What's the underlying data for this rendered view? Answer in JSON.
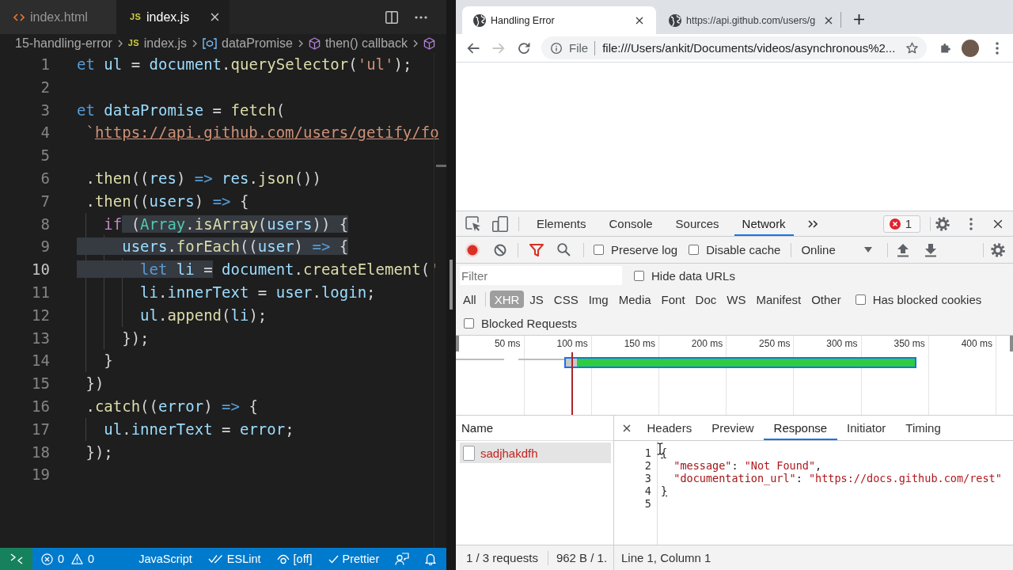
{
  "editor": {
    "tabs": [
      {
        "label": "index.html",
        "kind": "html",
        "selected": false
      },
      {
        "label": "index.js",
        "kind": "js",
        "file_badge": "JS",
        "selected": true
      }
    ],
    "breadcrumbs": [
      {
        "kind": "folder",
        "label": "15-handling-error"
      },
      {
        "kind": "js",
        "file_badge": "JS",
        "label": "index.js"
      },
      {
        "kind": "variable",
        "label": "dataPromise"
      },
      {
        "kind": "method",
        "label": "then() callback"
      },
      {
        "kind": "method"
      }
    ],
    "lines": [
      {
        "number": "1",
        "current": false,
        "tokens": [
          {
            "text": "et",
            "kind": "keyword"
          },
          {
            "text": " ul",
            "kind": "variable"
          },
          {
            "text": " = ",
            "kind": "plain"
          },
          {
            "text": "document",
            "kind": "variable"
          },
          {
            "text": ".",
            "kind": "plain"
          },
          {
            "text": "querySelector",
            "kind": "function"
          },
          {
            "text": "(",
            "kind": "plain"
          },
          {
            "text": "'ul'",
            "kind": "string"
          },
          {
            "text": ");",
            "kind": "plain"
          }
        ]
      },
      {
        "number": "2",
        "current": false
      },
      {
        "number": "3",
        "current": false,
        "tokens": [
          {
            "text": "et",
            "kind": "keyword"
          },
          {
            "text": " dataPromise",
            "kind": "variable"
          },
          {
            "text": " = ",
            "kind": "plain"
          },
          {
            "text": "fetch",
            "kind": "function"
          },
          {
            "text": "(",
            "kind": "plain"
          }
        ]
      },
      {
        "number": "4",
        "current": false,
        "tokens": [
          {
            "text": " `",
            "kind": "string"
          },
          {
            "text": "https://api.github.com/users/getify/fo",
            "kind": "link"
          }
        ]
      },
      {
        "number": "5",
        "current": false
      },
      {
        "number": "6",
        "current": false,
        "tokens": [
          {
            "text": " .",
            "kind": "plain"
          },
          {
            "text": "then",
            "kind": "function"
          },
          {
            "text": "((",
            "kind": "plain"
          },
          {
            "text": "res",
            "kind": "variable"
          },
          {
            "text": ") ",
            "kind": "plain"
          },
          {
            "text": "=>",
            "kind": "keyword"
          },
          {
            "text": " res",
            "kind": "variable"
          },
          {
            "text": ".",
            "kind": "plain"
          },
          {
            "text": "json",
            "kind": "function"
          },
          {
            "text": "())",
            "kind": "plain"
          }
        ]
      },
      {
        "number": "7",
        "current": false,
        "tokens": [
          {
            "text": " .",
            "kind": "plain"
          },
          {
            "text": "then",
            "kind": "function"
          },
          {
            "text": "((",
            "kind": "plain"
          },
          {
            "text": "users",
            "kind": "variable"
          },
          {
            "text": ") ",
            "kind": "plain"
          },
          {
            "text": "=>",
            "kind": "keyword"
          },
          {
            "text": " {",
            "kind": "plain"
          }
        ]
      },
      {
        "number": "8",
        "current": false,
        "tokens": [
          {
            "text": "   if",
            "kind": "control",
            "selected": false
          },
          {
            "text": " (",
            "kind": "plain",
            "selected": true
          },
          {
            "text": "Array",
            "kind": "class",
            "selected": true
          },
          {
            "text": ".",
            "kind": "plain",
            "selected": true
          },
          {
            "text": "isArray",
            "kind": "function",
            "selected": true
          },
          {
            "text": "(",
            "kind": "plain",
            "selected": true
          },
          {
            "text": "users",
            "kind": "variable",
            "selected": true
          },
          {
            "text": ")) {",
            "kind": "plain",
            "selected": true
          }
        ]
      },
      {
        "number": "9",
        "current": false,
        "tokens": [
          {
            "text": "     users",
            "kind": "variable",
            "selected": true
          },
          {
            "text": ".",
            "kind": "plain",
            "selected": true
          },
          {
            "text": "forEach",
            "kind": "function",
            "selected": true
          },
          {
            "text": "((",
            "kind": "plain",
            "selected": true
          },
          {
            "text": "user",
            "kind": "variable",
            "selected": true
          },
          {
            "text": ") ",
            "kind": "plain",
            "selected": true
          },
          {
            "text": "=>",
            "kind": "keyword",
            "selected": true
          },
          {
            "text": " {",
            "kind": "plain",
            "selected": true
          }
        ]
      },
      {
        "number": "10",
        "current": true,
        "tokens": [
          {
            "text": "       let",
            "kind": "keyword",
            "selected": true
          },
          {
            "text": " li",
            "kind": "variable",
            "selected": true
          },
          {
            "text": " =",
            "kind": "plain",
            "selected": true
          },
          {
            "text": " document",
            "kind": "variable",
            "selected": false
          },
          {
            "text": ".",
            "kind": "plain",
            "selected": false
          },
          {
            "text": "createElement",
            "kind": "function",
            "selected": false
          },
          {
            "text": "(",
            "kind": "plain",
            "selected": false
          },
          {
            "text": "'",
            "kind": "string",
            "selected": false
          }
        ]
      },
      {
        "number": "11",
        "current": false,
        "tokens": [
          {
            "text": "       li",
            "kind": "variable"
          },
          {
            "text": ".",
            "kind": "plain"
          },
          {
            "text": "innerText",
            "kind": "variable"
          },
          {
            "text": " = ",
            "kind": "plain"
          },
          {
            "text": "user",
            "kind": "variable"
          },
          {
            "text": ".",
            "kind": "plain"
          },
          {
            "text": "login",
            "kind": "variable"
          },
          {
            "text": ";",
            "kind": "plain"
          }
        ]
      },
      {
        "number": "12",
        "current": false,
        "tokens": [
          {
            "text": "       ul",
            "kind": "variable"
          },
          {
            "text": ".",
            "kind": "plain"
          },
          {
            "text": "append",
            "kind": "function"
          },
          {
            "text": "(",
            "kind": "plain"
          },
          {
            "text": "li",
            "kind": "variable"
          },
          {
            "text": ");",
            "kind": "plain"
          }
        ]
      },
      {
        "number": "13",
        "current": false,
        "tokens": [
          {
            "text": "     });",
            "kind": "plain"
          }
        ]
      },
      {
        "number": "14",
        "current": false,
        "tokens": [
          {
            "text": "   }",
            "kind": "plain"
          }
        ]
      },
      {
        "number": "15",
        "current": false,
        "tokens": [
          {
            "text": " })",
            "kind": "plain"
          }
        ]
      },
      {
        "number": "16",
        "current": false,
        "tokens": [
          {
            "text": " .",
            "kind": "plain"
          },
          {
            "text": "catch",
            "kind": "function"
          },
          {
            "text": "((",
            "kind": "plain"
          },
          {
            "text": "error",
            "kind": "variable"
          },
          {
            "text": ") ",
            "kind": "plain"
          },
          {
            "text": "=>",
            "kind": "keyword"
          },
          {
            "text": " {",
            "kind": "plain"
          }
        ]
      },
      {
        "number": "17",
        "current": false,
        "tokens": [
          {
            "text": "   ul",
            "kind": "variable"
          },
          {
            "text": ".",
            "kind": "plain"
          },
          {
            "text": "innerText",
            "kind": "variable"
          },
          {
            "text": " = ",
            "kind": "plain"
          },
          {
            "text": "error",
            "kind": "variable"
          },
          {
            "text": ";",
            "kind": "plain"
          }
        ]
      },
      {
        "number": "18",
        "current": false,
        "tokens": [
          {
            "text": " });",
            "kind": "plain"
          }
        ]
      },
      {
        "number": "19",
        "current": false
      }
    ],
    "status_bar": {
      "problems": [
        {
          "kind": "error",
          "count": "0"
        },
        {
          "kind": "warning",
          "count": "0"
        }
      ],
      "items": [
        {
          "kind": "language",
          "label": "JavaScript"
        },
        {
          "kind": "eslint",
          "label": "ESLint"
        },
        {
          "kind": "watch",
          "label": "[off]"
        },
        {
          "kind": "prettier",
          "label": "Prettier"
        },
        {
          "kind": "feedback"
        },
        {
          "kind": "notifications"
        }
      ]
    }
  },
  "browser": {
    "tabs": [
      {
        "title": "Handling Error",
        "selected": true
      },
      {
        "title": "https://api.github.com/users/g",
        "selected": false
      }
    ],
    "nav": [
      {
        "kind": "back",
        "disabled": false
      },
      {
        "kind": "forward",
        "disabled": true
      },
      {
        "kind": "reload",
        "disabled": false
      }
    ],
    "omnibox": {
      "scheme": "File",
      "url": "file:///Users/ankit/Documents/videos/asynchronous%2..."
    }
  },
  "devtools": {
    "panels": [
      {
        "label": "Elements",
        "selected": false
      },
      {
        "label": "Console",
        "selected": false
      },
      {
        "label": "Sources",
        "selected": false
      },
      {
        "label": "Network",
        "selected": true
      }
    ],
    "error_count": "1",
    "recording": true,
    "options": [
      {
        "label": "Preserve log",
        "checked": false
      },
      {
        "label": "Disable cache",
        "checked": false
      }
    ],
    "throttling": "Online",
    "filter": {
      "placeholder": "Filter"
    },
    "hide_data_urls": {
      "label": "Hide data URLs",
      "checked": false
    },
    "resource_types": [
      {
        "label": "All",
        "selected": false
      },
      {
        "label": "XHR",
        "selected": true
      },
      {
        "label": "JS",
        "selected": false
      },
      {
        "label": "CSS",
        "selected": false
      },
      {
        "label": "Img",
        "selected": false
      },
      {
        "label": "Media",
        "selected": false
      },
      {
        "label": "Font",
        "selected": false
      },
      {
        "label": "Doc",
        "selected": false
      },
      {
        "label": "WS",
        "selected": false
      },
      {
        "label": "Manifest",
        "selected": false
      },
      {
        "label": "Other",
        "selected": false
      }
    ],
    "has_blocked_cookies": {
      "label": "Has blocked cookies",
      "checked": false
    },
    "blocked_requests": {
      "label": "Blocked Requests",
      "checked": false
    },
    "timeline": {
      "ticks": [
        "50 ms",
        "100 ms",
        "150 ms",
        "200 ms",
        "250 ms",
        "300 ms",
        "350 ms",
        "400 ms"
      ]
    },
    "requests": {
      "column": "Name",
      "rows": [
        {
          "name": "sadjhakdfh",
          "failed": true,
          "selected": true
        }
      ]
    },
    "detail_tabs": [
      {
        "label": "Headers",
        "selected": false
      },
      {
        "label": "Preview",
        "selected": false
      },
      {
        "label": "Response",
        "selected": true
      },
      {
        "label": "Initiator",
        "selected": false
      },
      {
        "label": "Timing",
        "selected": false
      }
    ],
    "response": [
      {
        "number": "1",
        "tokens": [
          {
            "text": "{",
            "kind": "brace"
          }
        ]
      },
      {
        "number": "2",
        "tokens": [
          {
            "text": "  \"message\"",
            "kind": "key"
          },
          {
            "text": ": ",
            "kind": "plain"
          },
          {
            "text": "\"Not Found\"",
            "kind": "string"
          },
          {
            "text": ",",
            "kind": "plain"
          }
        ]
      },
      {
        "number": "3",
        "tokens": [
          {
            "text": "  \"documentation_url\"",
            "kind": "key"
          },
          {
            "text": ": ",
            "kind": "plain"
          },
          {
            "text": "\"https://docs.github.com/rest\"",
            "kind": "string"
          }
        ]
      },
      {
        "number": "4",
        "tokens": [
          {
            "text": "}",
            "kind": "brace"
          }
        ]
      },
      {
        "number": "5"
      }
    ],
    "summary": [
      "1 / 3 requests",
      "962 B / 1."
    ],
    "cursor_position": "Line 1, Column 1"
  }
}
